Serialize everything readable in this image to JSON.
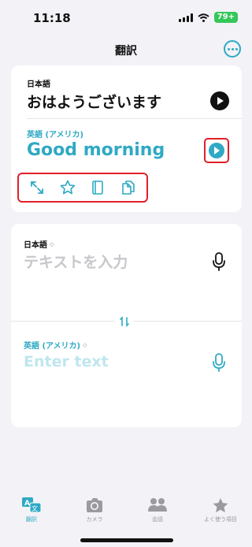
{
  "status": {
    "time": "11:18",
    "battery": "79+"
  },
  "nav": {
    "title": "翻訳"
  },
  "translation": {
    "source_lang": "日本語",
    "source_text": "おはようございます",
    "target_lang": "英語 (アメリカ)",
    "target_text": "Good morning"
  },
  "input": {
    "source_lang": "日本語",
    "source_placeholder": "テキストを入力",
    "target_lang": "英語 (アメリカ)",
    "target_placeholder": "Enter text"
  },
  "tabs": [
    {
      "label": "翻訳",
      "icon": "translate-icon",
      "active": true
    },
    {
      "label": "カメラ",
      "icon": "camera-icon",
      "active": false
    },
    {
      "label": "会話",
      "icon": "people-icon",
      "active": false
    },
    {
      "label": "よく使う項目",
      "icon": "star-icon",
      "active": false
    }
  ],
  "colors": {
    "accent": "#2fa9c4",
    "highlight": "#e0202a",
    "background": "#f2f2f7"
  }
}
